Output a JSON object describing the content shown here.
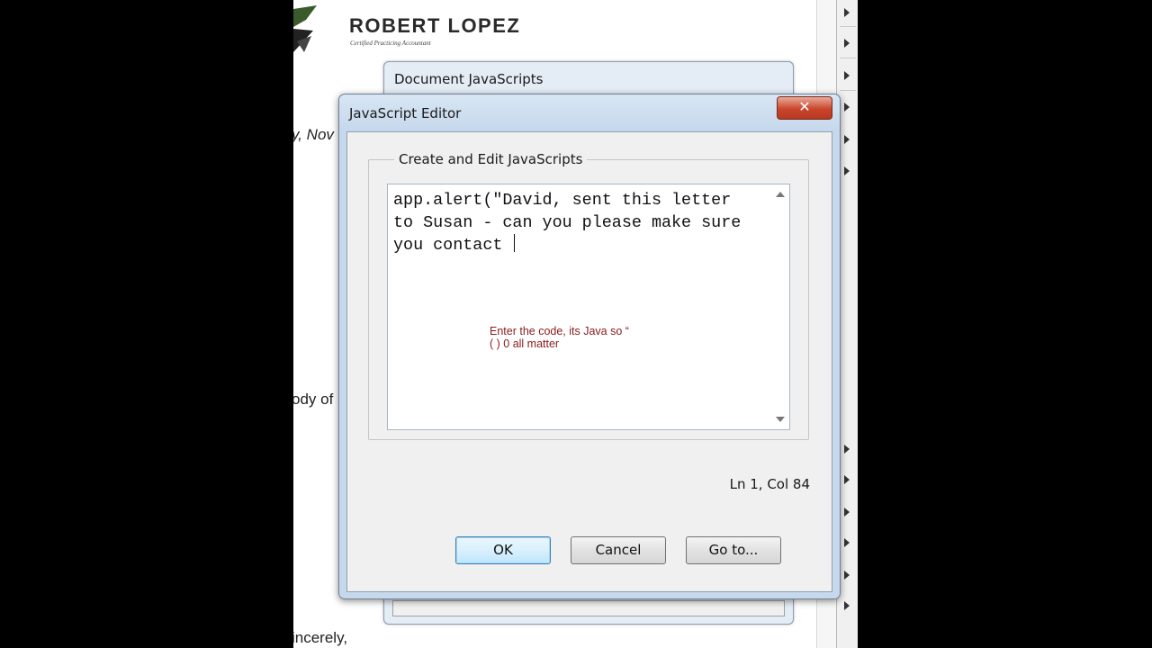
{
  "document": {
    "brand": "ROBERT LOPEZ",
    "brand_subtitle": "Certified Practicing Accountant",
    "line1": "y, Nov",
    "line2": "ody of",
    "line3": "incerely,"
  },
  "doc_js_window": {
    "title": "Document JavaScripts"
  },
  "editor": {
    "title": "JavaScript Editor",
    "close_label": "✕",
    "group_label": "Create and Edit JavaScripts",
    "code": "app.alert(\"David, sent this letter to Susan - can you please make sure you contact ",
    "annotation_line1": "Enter the code, its Java so “",
    "annotation_line2": "( ) 0 all matter",
    "status": "Ln 1, Col 84",
    "buttons": {
      "ok": "OK",
      "cancel": "Cancel",
      "goto": "Go to..."
    }
  },
  "colors": {
    "annotation": "#8b1a1a",
    "close_button": "#c9452b",
    "dialog_frame": "#c6d8ec"
  }
}
